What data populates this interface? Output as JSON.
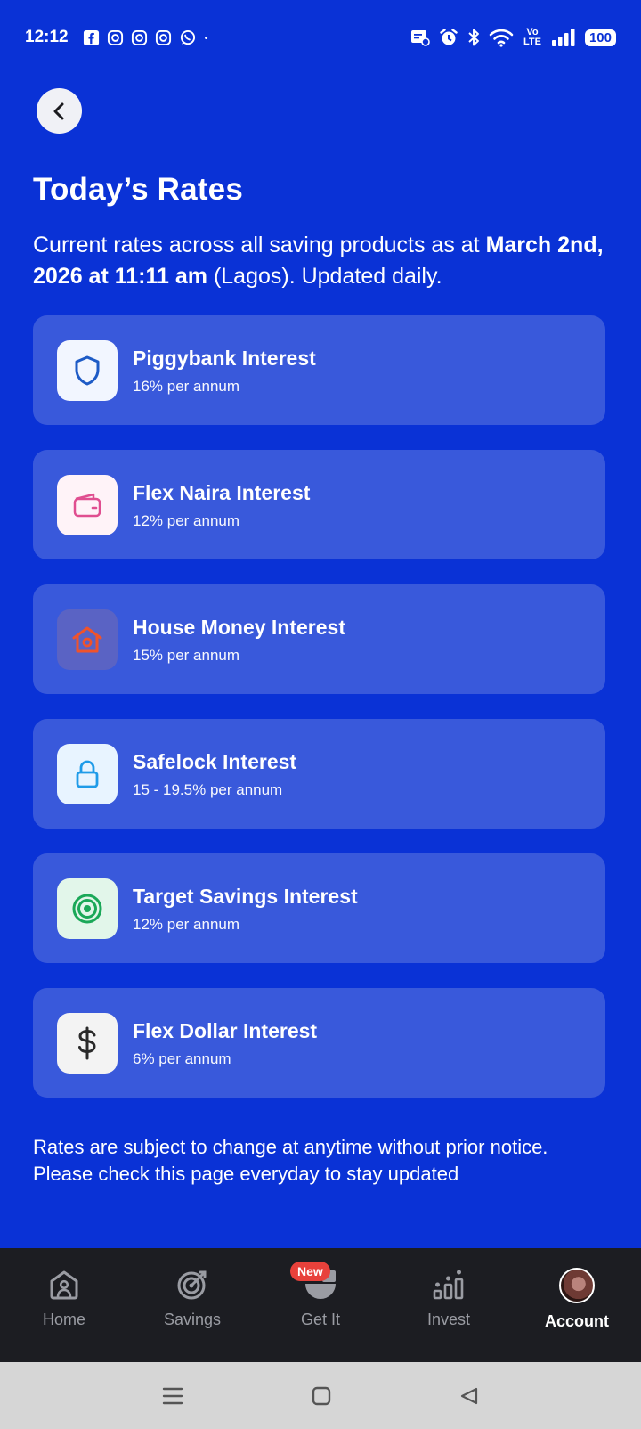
{
  "status_bar": {
    "time": "12:12",
    "network": "Vo LTE",
    "battery": "100"
  },
  "page": {
    "title": "Today’s Rates",
    "intro_prefix": "Current rates across all saving products as at ",
    "intro_date": "March 2nd, 2026 at 11:11 am",
    "intro_suffix": " (Lagos). Updated daily.",
    "disclaimer": "Rates are subject to change at anytime without prior notice. Please check this page everyday to stay updated"
  },
  "rates": [
    {
      "name": "Piggybank Interest",
      "value": "16% per annum",
      "icon": "shield-icon",
      "tile_color": "#f2f6ff",
      "icon_color": "#1e5bc6"
    },
    {
      "name": "Flex Naira Interest",
      "value": "12% per annum",
      "icon": "wallet-icon",
      "tile_color": "#fff3f8",
      "icon_color": "#e04e90"
    },
    {
      "name": "House Money Interest",
      "value": "15% per annum",
      "icon": "house-icon",
      "tile_color": "#5a63c4",
      "icon_color": "#f0532b"
    },
    {
      "name": "Safelock Interest",
      "value": "15 - 19.5% per annum",
      "icon": "lock-icon",
      "tile_color": "#e8f4ff",
      "icon_color": "#1f9be8"
    },
    {
      "name": "Target Savings Interest",
      "value": "12% per annum",
      "icon": "target-icon",
      "tile_color": "#e2f6ea",
      "icon_color": "#1aa858"
    },
    {
      "name": "Flex Dollar Interest",
      "value": "6% per annum",
      "icon": "dollar-icon",
      "tile_color": "#f3f3f3",
      "icon_color": "#2a2a2a"
    }
  ],
  "bottom_nav": {
    "items": [
      {
        "label": "Home",
        "icon": "home-icon"
      },
      {
        "label": "Savings",
        "icon": "savings-target-icon"
      },
      {
        "label": "Get It",
        "icon": "get-it-icon",
        "badge": "New"
      },
      {
        "label": "Invest",
        "icon": "invest-chart-icon"
      },
      {
        "label": "Account",
        "icon": "avatar",
        "active": true
      }
    ]
  },
  "colors": {
    "background": "#0a32d6",
    "card": "#3959db",
    "nav_bg": "#1c1d22",
    "badge": "#e8413b"
  }
}
